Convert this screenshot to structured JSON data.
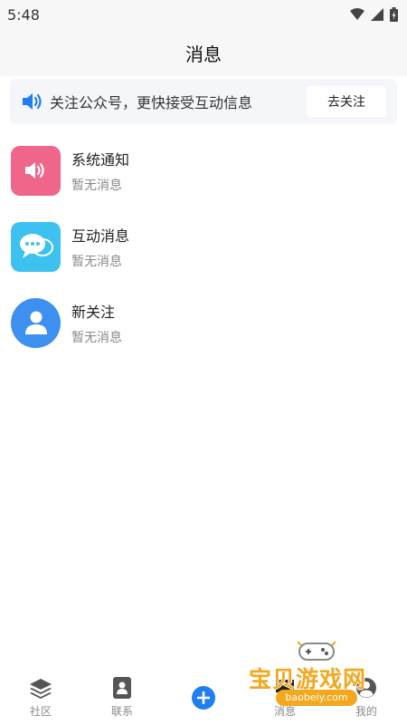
{
  "status_bar": {
    "time": "5:48"
  },
  "header": {
    "title": "消息"
  },
  "banner": {
    "text": "关注公众号，更快接受互动信息",
    "button_label": "去关注"
  },
  "messages": [
    {
      "title": "系统通知",
      "subtitle": "暂无消息",
      "icon": "speaker-icon",
      "color": "#f0668b"
    },
    {
      "title": "互动消息",
      "subtitle": "暂无消息",
      "icon": "chat-bubbles-icon",
      "color": "#3dc1ee"
    },
    {
      "title": "新关注",
      "subtitle": "暂无消息",
      "icon": "user-icon",
      "color": "#3d8ff0"
    }
  ],
  "bottom_nav": {
    "items": [
      {
        "label": "社区",
        "icon": "layers-icon"
      },
      {
        "label": "联系",
        "icon": "contacts-icon"
      },
      {
        "label": "",
        "icon": "plus-icon"
      },
      {
        "label": "消息",
        "icon": "message-icon"
      },
      {
        "label": "我的",
        "icon": "profile-icon"
      }
    ]
  },
  "watermark": {
    "text": "宝贝游戏网",
    "url": "baobeiy.com"
  },
  "colors": {
    "accent": "#1e7ef2",
    "banner_bg": "#f4f6f9",
    "watermark": "#f3a81e"
  }
}
